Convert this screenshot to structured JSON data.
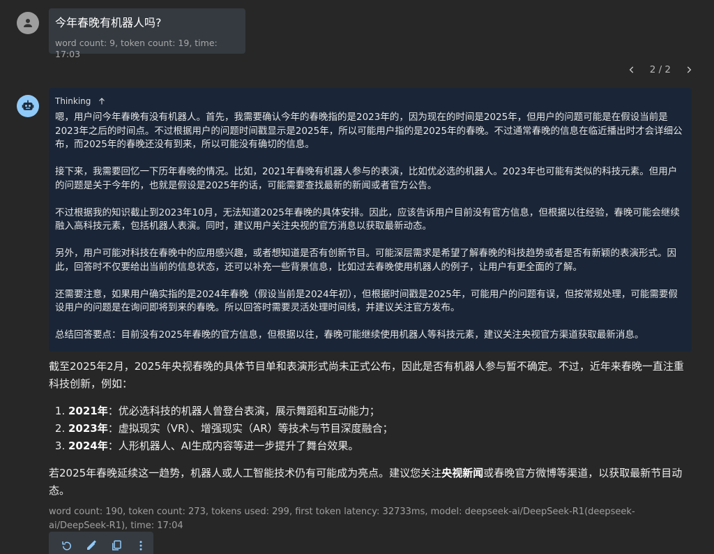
{
  "user_message": {
    "text": "今年春晚有机器人吗?",
    "meta": "word count: 9, token count: 19, time: 17:03"
  },
  "pager": {
    "label": "2 / 2"
  },
  "thinking": {
    "label": "Thinking",
    "paragraphs": [
      "嗯，用户问今年春晚有没有机器人。首先，我需要确认今年的春晚指的是2023年的，因为现在的时间是2025年，但用户的问题可能是在假设当前是2023年之后的时间点。不过根据用户的问题时间戳显示是2025年，所以可能用户指的是2025年的春晚。不过通常春晚的信息在临近播出时才会详细公布，而2025年的春晚还没有到来，所以可能没有确切的信息。",
      "接下来，我需要回忆一下历年春晚的情况。比如，2021年春晚有机器人参与的表演，比如优必选的机器人。2023年也可能有类似的科技元素。但用户的问题是关于今年的，也就是假设是2025年的话，可能需要查找最新的新闻或者官方公告。",
      "不过根据我的知识截止到2023年10月，无法知道2025年春晚的具体安排。因此，应该告诉用户目前没有官方信息，但根据以往经验，春晚可能会继续融入高科技元素，包括机器人表演。同时，建议用户关注央视的官方消息以获取最新动态。",
      "另外，用户可能对科技在春晚中的应用感兴趣，或者想知道是否有创新节目。可能深层需求是希望了解春晚的科技趋势或者是否有新颖的表演形式。因此，回答时不仅要给出当前的信息状态，还可以补充一些背景信息，比如过去春晚使用机器人的例子，让用户有更全面的了解。",
      "还需要注意，如果用户确实指的是2024年春晚（假设当前是2024年初），但根据时间戳是2025年，可能用户的问题有误，但按常规处理，可能需要假设用户的问题是在询问即将到来的春晚。所以回答时需要灵活处理时间线，并建议关注官方发布。",
      "总结回答要点：目前没有2025年春晚的官方信息，但根据以往，春晚可能继续使用机器人等科技元素，建议关注央视官方渠道获取最新消息。"
    ]
  },
  "answer": {
    "intro": "截至2025年2月，2025年央视春晚的具体节目单和表演形式尚未正式公布，因此是否有机器人参与暂不确定。不过，近年来春晚一直注重科技创新，例如：",
    "items": [
      {
        "year": "2021年",
        "text": "：优必选科技的机器人曾登台表演，展示舞蹈和互动能力；"
      },
      {
        "year": "2023年",
        "text": "：虚拟现实（VR）、增强现实（AR）等技术与节目深度融合；"
      },
      {
        "year": "2024年",
        "text": "：人形机器人、AI生成内容等进一步提升了舞台效果。"
      }
    ],
    "outro_before": "若2025年春晚延续这一趋势，机器人或人工智能技术仍有可能成为亮点。建议您关注",
    "outro_bold": "央视新闻",
    "outro_after": "或春晚官方微博等渠道，以获取最新节目动态。",
    "meta": "word count: 190, token count: 273, tokens used: 299, first token latency: 32733ms, model: deepseek-ai/DeepSeek-R1(deepseek-ai/DeepSeek-R1), time: 17:04"
  },
  "toolbar": {
    "icons": [
      "refresh-icon",
      "edit-icon",
      "copy-icon",
      "more-vertical-icon"
    ]
  }
}
